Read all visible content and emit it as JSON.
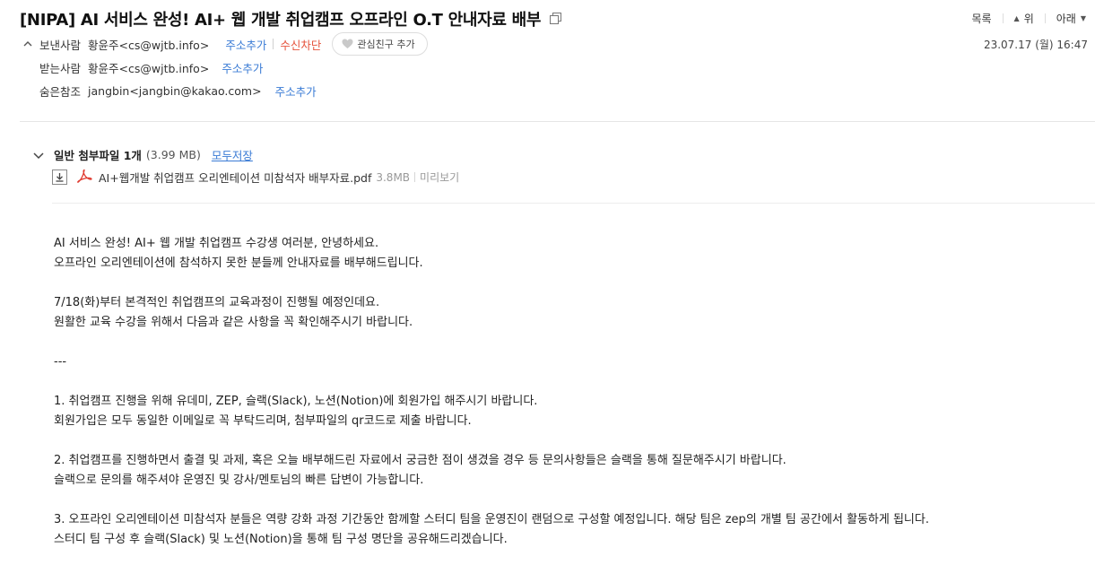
{
  "subject": "[NIPA] AI 서비스 완성! AI+ 웹 개발 취업캠프 오프라인 O.T 안내자료 배부",
  "nav": {
    "list": "목록",
    "up": "위",
    "down": "아래"
  },
  "sender": {
    "label": "보낸사람",
    "value": "황윤주<cs@wjtb.info>",
    "add_address": "주소추가",
    "block": "수신차단",
    "favorite": "관심친구 추가"
  },
  "recipient": {
    "label": "받는사람",
    "value": "황윤주<cs@wjtb.info>",
    "add_address": "주소추가"
  },
  "bcc": {
    "label": "숨은참조",
    "value": "jangbin<jangbin@kakao.com>",
    "add_address": "주소추가"
  },
  "date": "23.07.17 (월) 16:47",
  "attachments": {
    "title": "일반 첨부파일 1개",
    "total_size": "(3.99 MB)",
    "save_all": "모두저장",
    "files": [
      {
        "name": "AI+웹개발 취업캠프 오리엔테이션 미참석자 배부자료.pdf",
        "size": "3.8MB",
        "preview": "미리보기"
      }
    ]
  },
  "body": {
    "lines": [
      "AI 서비스 완성! AI+ 웹 개발 취업캠프 수강생 여러분, 안녕하세요.",
      "오프라인 오리엔테이션에 참석하지 못한 분들께 안내자료를 배부해드립니다.",
      "",
      "7/18(화)부터 본격적인 취업캠프의 교육과정이 진행될 예정인데요.",
      "원활한 교육 수강을 위해서 다음과 같은 사항을 꼭 확인해주시기 바랍니다.",
      "",
      "---",
      "",
      "1. 취업캠프 진행을 위해 유데미, ZEP, 슬랙(Slack), 노션(Notion)에 회원가입 해주시기 바랍니다.",
      "회원가입은 모두 동일한 이메일로 꼭 부탁드리며, 첨부파일의 qr코드로 제출 바랍니다.",
      "",
      "2. 취업캠프를 진행하면서 출결 및 과제, 혹은 오늘 배부해드린 자료에서 궁금한 점이 생겼을 경우 등 문의사항들은 슬랙을 통해 질문해주시기 바랍니다.",
      "슬랙으로 문의를 해주셔야 운영진 및 강사/멘토님의 빠른 답변이 가능합니다.",
      "",
      "3. 오프라인 오리엔테이션 미참석자 분들은 역량 강화 과정 기간동안 함께할 스터디 팀을 운영진이 랜덤으로 구성할 예정입니다. 해당 팀은 zep의 개별 팀 공간에서 활동하게 됩니다.",
      "스터디 팀 구성 후 슬랙(Slack) 및 노션(Notion)을 통해 팀 구성 명단을 공유해드리겠습니다."
    ]
  },
  "colors": {
    "link": "#3a7bd5",
    "block": "#e5533c",
    "pdf": "#e03c31"
  }
}
